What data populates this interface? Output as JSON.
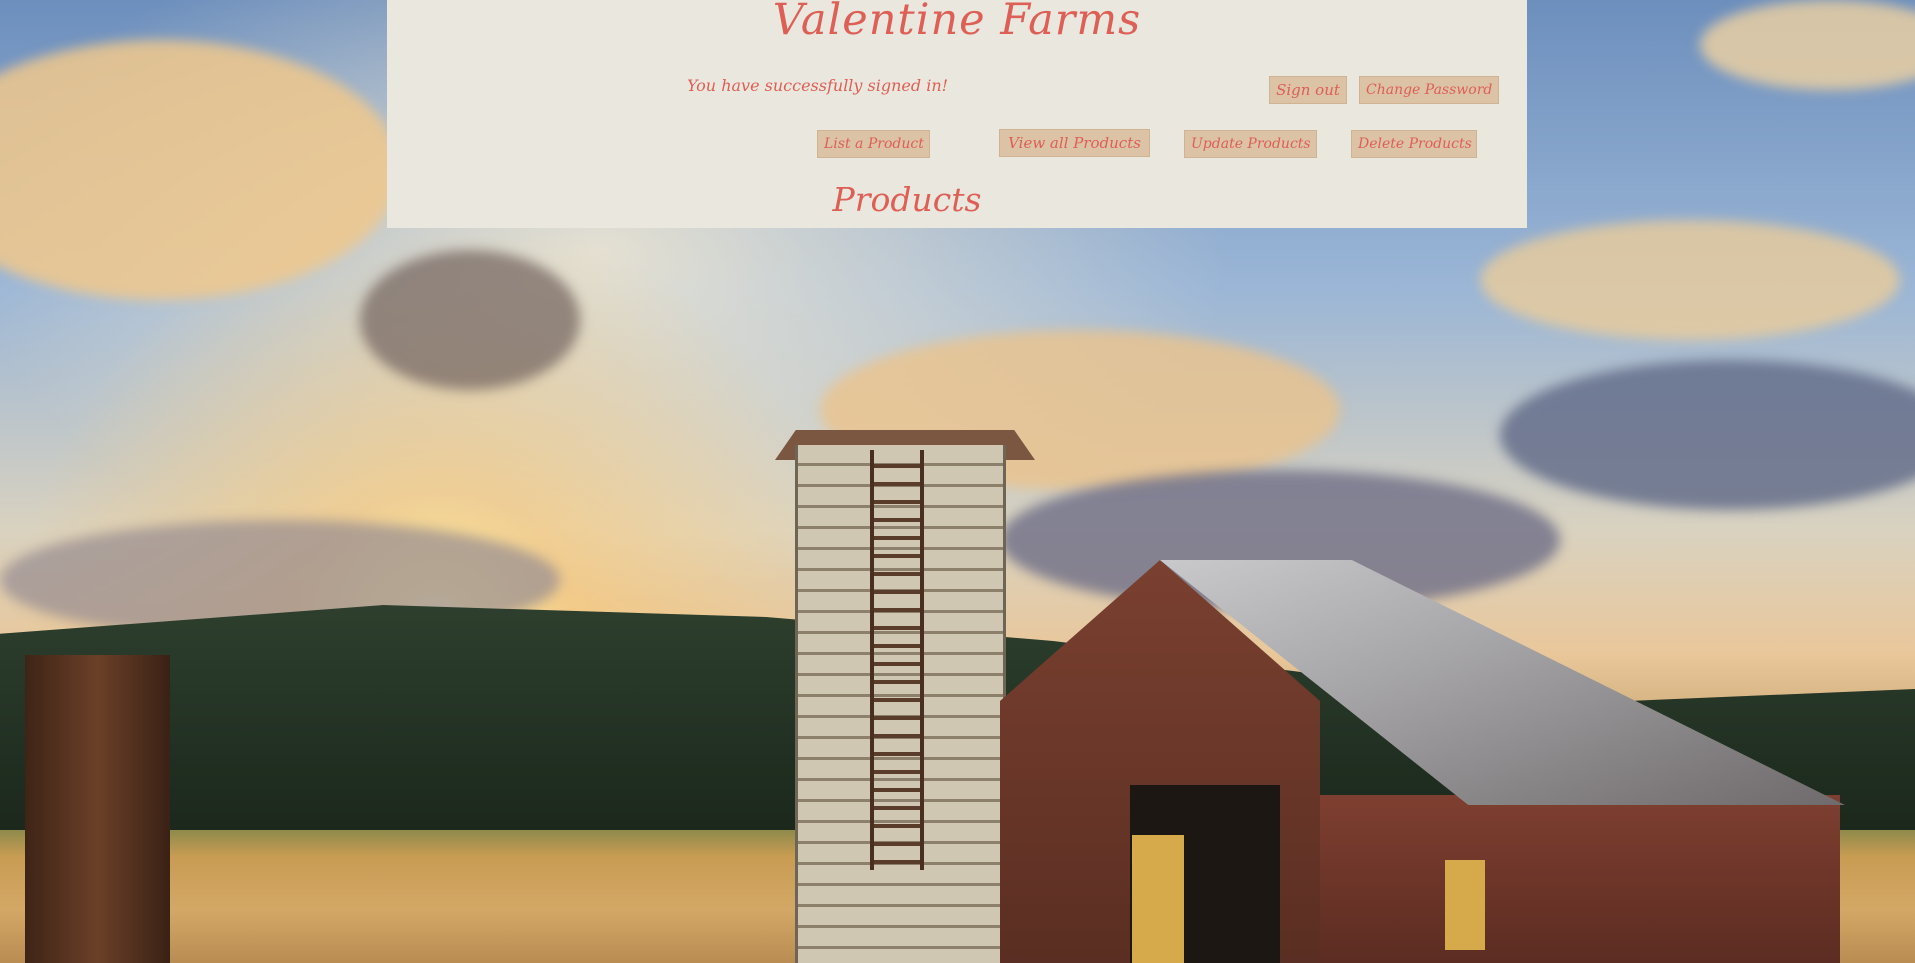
{
  "app": {
    "title": "Valentine Farms"
  },
  "status": {
    "message": "You have successfully signed in!"
  },
  "account_nav": {
    "sign_out_label": "Sign out",
    "change_password_label": "Change Password"
  },
  "product_nav": {
    "list_label": "List a Product",
    "view_all_label": "View all Products",
    "update_label": "Update Products",
    "delete_label": "Delete Products"
  },
  "main": {
    "section_title": "Products"
  },
  "theme": {
    "panel_background": "#eae7de",
    "accent_text": "#dd5f56",
    "button_background": "#dcc3a5"
  },
  "background": {
    "icon": "farm-sunset-photo"
  }
}
